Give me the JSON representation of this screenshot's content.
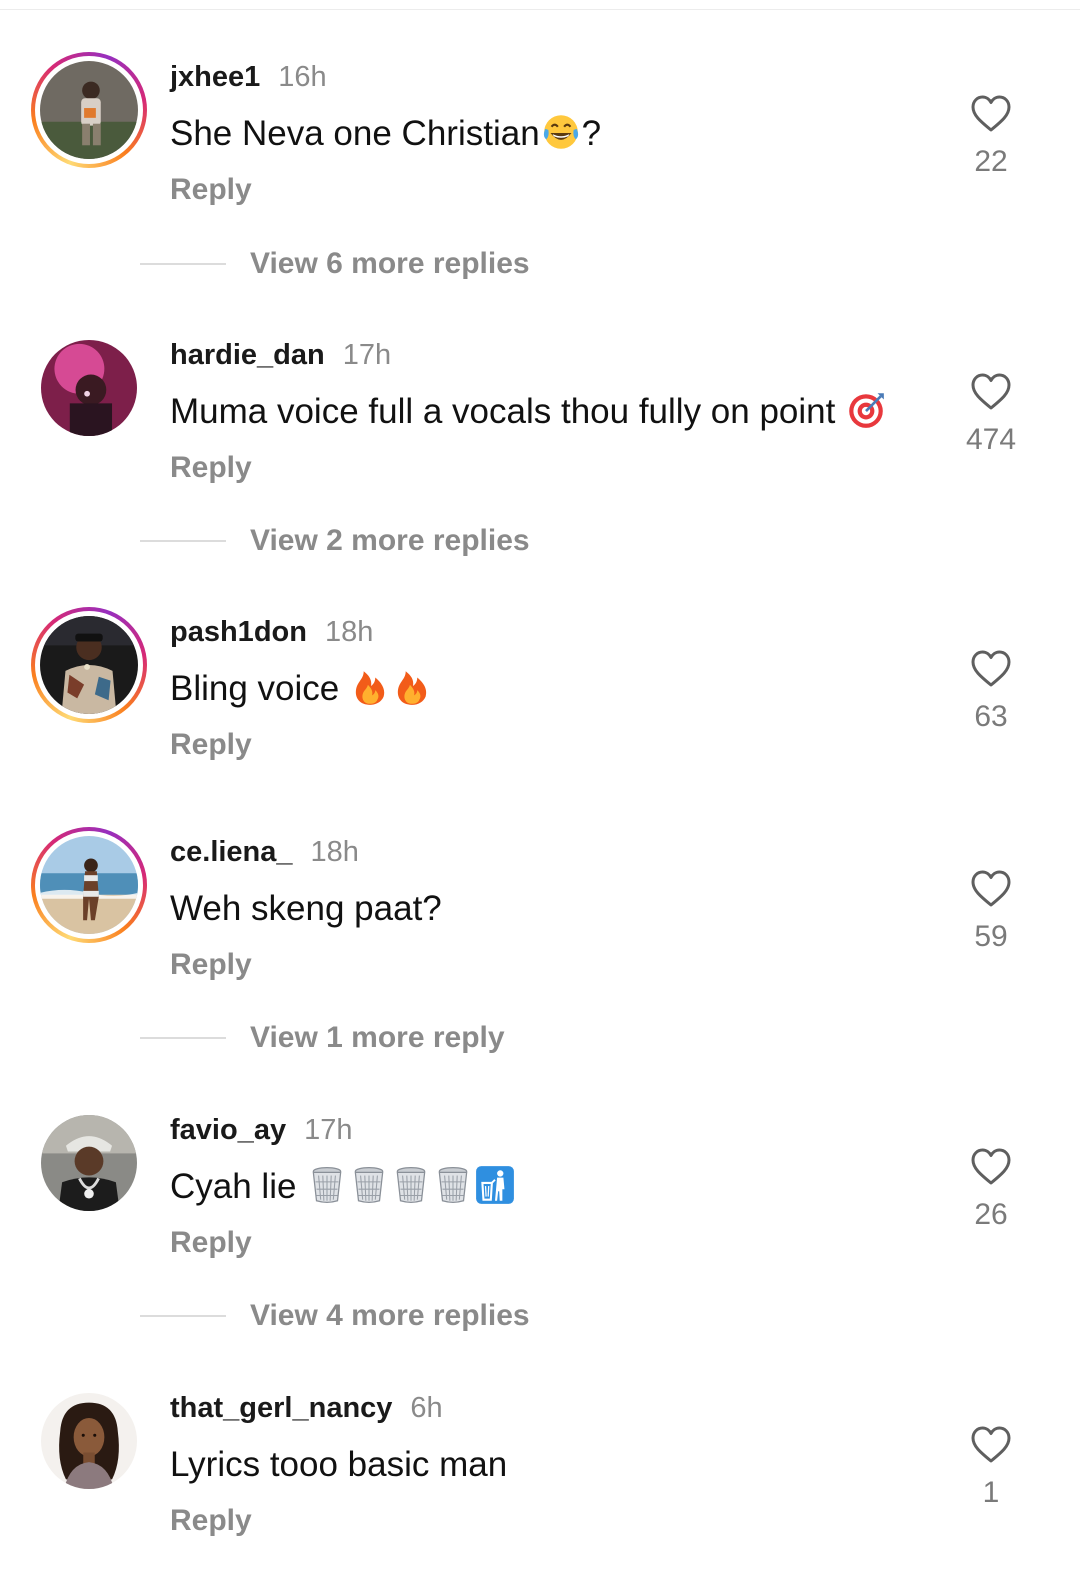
{
  "colors": {
    "background": "#ffffff",
    "username": "#1a1a1a",
    "secondary_text": "#8a8a8a",
    "story_ring": "instagram-gradient"
  },
  "comments": [
    {
      "username": "jxhee1",
      "time": "16h",
      "text": "She Neva one Christian",
      "emojis": [
        "face-with-tears-of-joy"
      ],
      "text_suffix": "?",
      "reply_label": "Reply",
      "likes": "22",
      "view_replies": "View 6 more replies",
      "story_ring": true
    },
    {
      "username": "hardie_dan",
      "time": "17h",
      "text": "Muma voice full a vocals thou fully on point",
      "emojis": [
        "direct-hit"
      ],
      "text_suffix": "",
      "reply_label": "Reply",
      "likes": "474",
      "view_replies": "View 2 more replies",
      "story_ring": false
    },
    {
      "username": "pash1don",
      "time": "18h",
      "text": "Bling voice",
      "emojis": [
        "fire",
        "fire"
      ],
      "text_suffix": "",
      "reply_label": "Reply",
      "likes": "63",
      "view_replies": "",
      "story_ring": true
    },
    {
      "username": "ce.liena_",
      "time": "18h",
      "text": "Weh skeng paat?",
      "emojis": [],
      "text_suffix": "",
      "reply_label": "Reply",
      "likes": "59",
      "view_replies": "View 1 more reply",
      "story_ring": true
    },
    {
      "username": "favio_ay",
      "time": "17h",
      "text": "Cyah lie",
      "emojis": [
        "wastebasket",
        "wastebasket",
        "wastebasket",
        "wastebasket",
        "put-litter-in-its-place"
      ],
      "text_suffix": "",
      "reply_label": "Reply",
      "likes": "26",
      "view_replies": "View 4 more replies",
      "story_ring": false
    },
    {
      "username": "that_gerl_nancy",
      "time": "6h",
      "text": "Lyrics tooo basic man",
      "emojis": [],
      "text_suffix": "",
      "reply_label": "Reply",
      "likes": "1",
      "view_replies": "",
      "story_ring": false
    }
  ],
  "icons": {
    "like": "heart-outline-icon"
  }
}
